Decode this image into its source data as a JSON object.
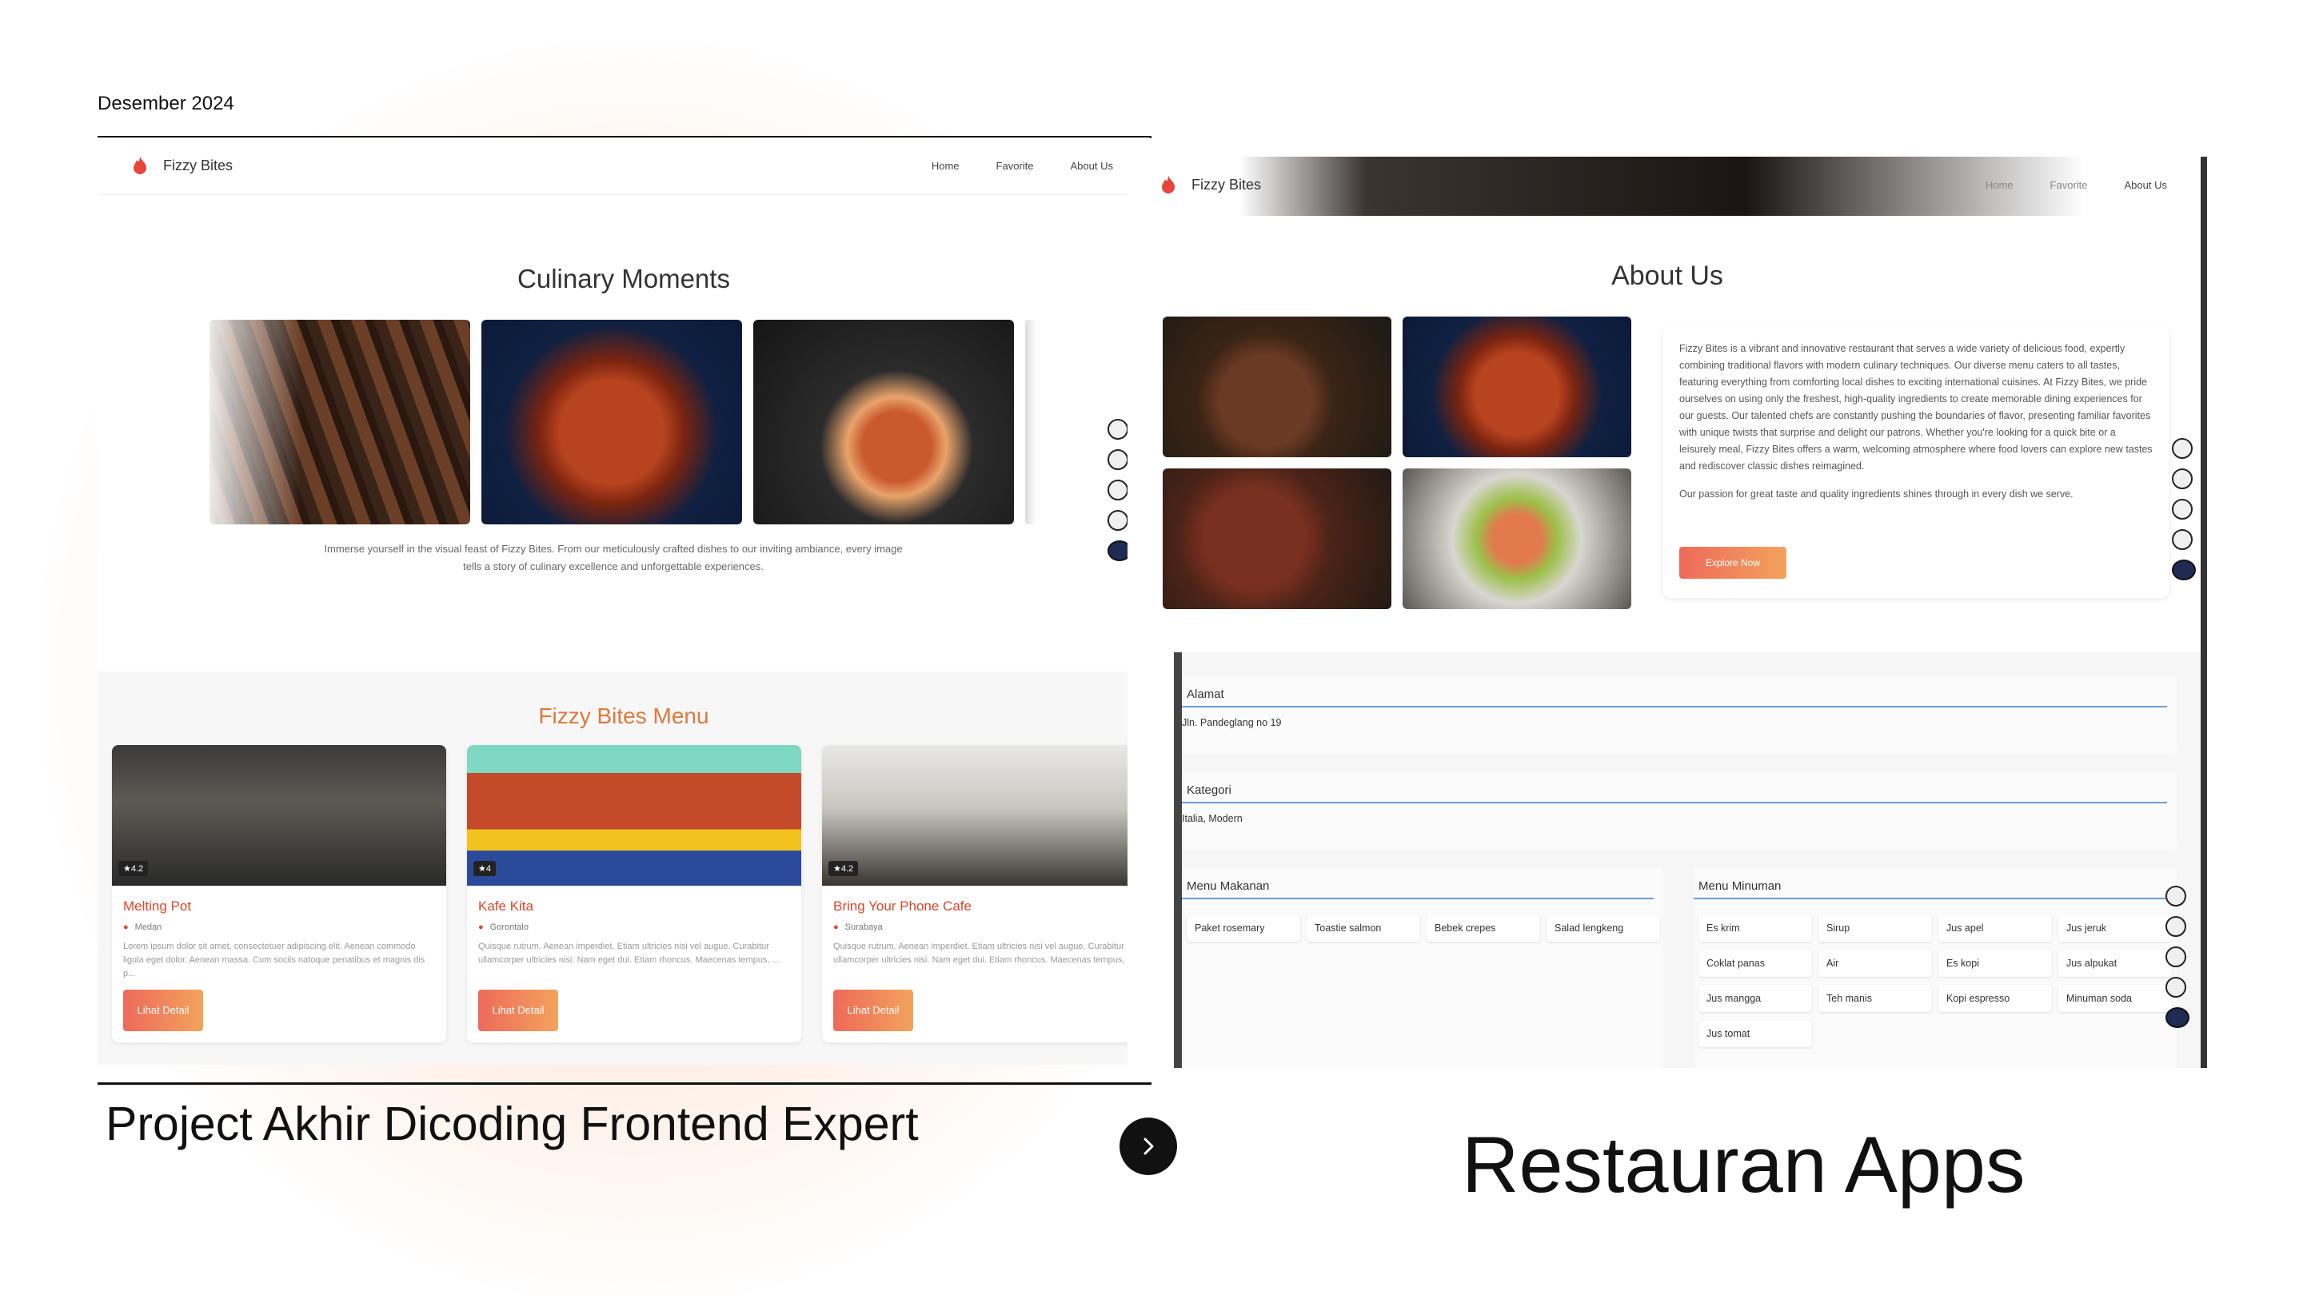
{
  "header": {
    "date": "Desember 2024"
  },
  "left_site": {
    "brand": "Fizzy Bites",
    "nav": [
      "Home",
      "Favorite",
      "About Us"
    ],
    "gallery_title": "Culinary Moments",
    "gallery_caption": "Immerse yourself in the visual feast of Fizzy Bites. From our meticulously crafted dishes to our inviting ambiance, every image tells a story of culinary excellence and unforgettable experiences.",
    "menu_title": "Fizzy Bites Menu",
    "restaurants": [
      {
        "name": "Melting Pot",
        "city": "Medan",
        "rating": "4.2",
        "description": "Lorem ipsum dolor sit amet, consectetuer adipiscing elit. Aenean commodo ligula eget dolor. Aenean massa. Cum sociis natoque penatibus et magnis dis p...",
        "button": "Lihat Detail"
      },
      {
        "name": "Kafe Kita",
        "city": "Gorontalo",
        "rating": "4",
        "description": "Quisque rutrum. Aenean imperdiet. Etiam ultricies nisi vel augue. Curabitur ullamcorper ultricies nisi. Nam eget dui. Etiam rhoncus. Maecenas tempus, ...",
        "button": "Lihat Detail"
      },
      {
        "name": "Bring Your Phone Cafe",
        "city": "Surabaya",
        "rating": "4.2",
        "description": "Quisque rutrum. Aenean imperdiet. Etiam ultricies nisi vel augue. Curabitur ullamcorper ultricies nisi. Nam eget dui. Etiam rhoncus. Maecenas tempus, ...",
        "button": "Lihat Detail"
      }
    ]
  },
  "right_site": {
    "brand": "Fizzy Bites",
    "nav": [
      "Home",
      "Favorite",
      "About Us"
    ],
    "about_title": "About Us",
    "about_text": "Fizzy Bites is a vibrant and innovative restaurant that serves a wide variety of delicious food, expertly combining traditional flavors with modern culinary techniques. Our diverse menu caters to all tastes, featuring everything from comforting local dishes to exciting international cuisines. At Fizzy Bites, we pride ourselves on using only the freshest, high-quality ingredients to create memorable dining experiences for our guests. Our talented chefs are constantly pushing the boundaries of flavor, presenting familiar favorites with unique twists that surprise and delight our patrons. Whether you're looking for a quick bite or a leisurely meal, Fizzy Bites offers a warm, welcoming atmosphere where food lovers can explore new tastes and rediscover classic dishes reimagined.",
    "about_text2": "Our passion for great taste and quality ingredients shines through in every dish we serve.",
    "explore_button": "Explore Now",
    "detail": {
      "alamat_label": "Alamat",
      "alamat_value": "Jln. Pandeglang no 19",
      "kategori_label": "Kategori",
      "kategori_value": "Italia, Modern",
      "menu_makanan_label": "Menu Makanan",
      "menu_makanan": [
        "Paket rosemary",
        "Toastie salmon",
        "Bebek crepes",
        "Salad lengkeng"
      ],
      "menu_minuman_label": "Menu Minuman",
      "menu_minuman": [
        "Es krim",
        "Sirup",
        "Jus apel",
        "Jus jeruk",
        "Coklat panas",
        "Air",
        "Es kopi",
        "Jus alpukat",
        "Jus mangga",
        "Teh manis",
        "Kopi espresso",
        "Minuman soda",
        "Jus tomat"
      ]
    }
  },
  "footer": {
    "left_title": "Project Akhir Dicoding Frontend Expert",
    "right_title": "Restauran Apps"
  },
  "icons": {
    "brand": "flame-icon",
    "next": "chevron-right-icon",
    "rating": "star-icon",
    "location": "pin-icon",
    "accessibility_tools": [
      "book-icon",
      "translate-icon",
      "globe-icon",
      "grid-icon",
      "assistant-icon"
    ]
  },
  "colors": {
    "accent": "#e0773b",
    "button_start": "#ee6a5b",
    "button_end": "#f3a35c",
    "card_title": "#e0452b",
    "divider": "#6b9ed1"
  }
}
